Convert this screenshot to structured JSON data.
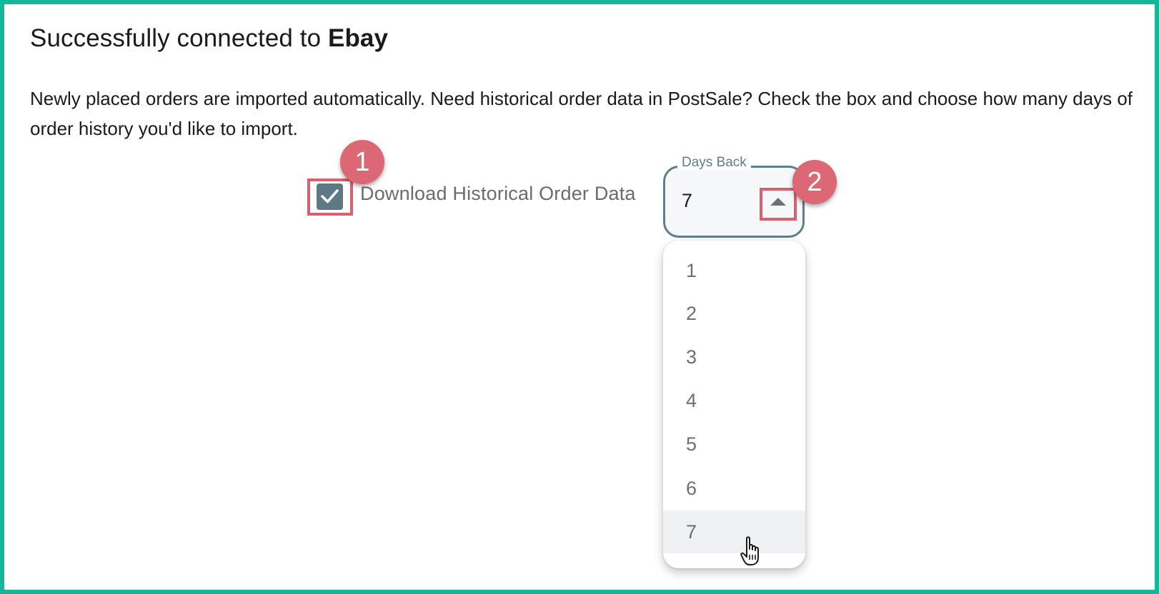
{
  "header": {
    "title_prefix": "Successfully connected to",
    "title_service": "Ebay"
  },
  "description": "Newly placed orders are imported automatically. Need historical order data in PostSale? Check the box and choose how many days of order history you'd like to import.",
  "checkbox": {
    "label": "Download Historical Order Data",
    "checked": true
  },
  "days_back": {
    "label": "Days Back",
    "value": "7",
    "options": [
      "1",
      "2",
      "3",
      "4",
      "5",
      "6",
      "7"
    ],
    "selected_index": 6
  },
  "annotations": {
    "badge_1": "1",
    "badge_2": "2"
  },
  "colors": {
    "frame": "#13b79a",
    "highlight": "#d9606f",
    "badge": "#dc6876",
    "checkbox": "#5f7886",
    "field_border": "#607d8b"
  },
  "icons": {
    "checkbox_check": "check-icon",
    "select_arrow": "arrow-up-icon",
    "cursor": "hand-pointer-icon"
  }
}
